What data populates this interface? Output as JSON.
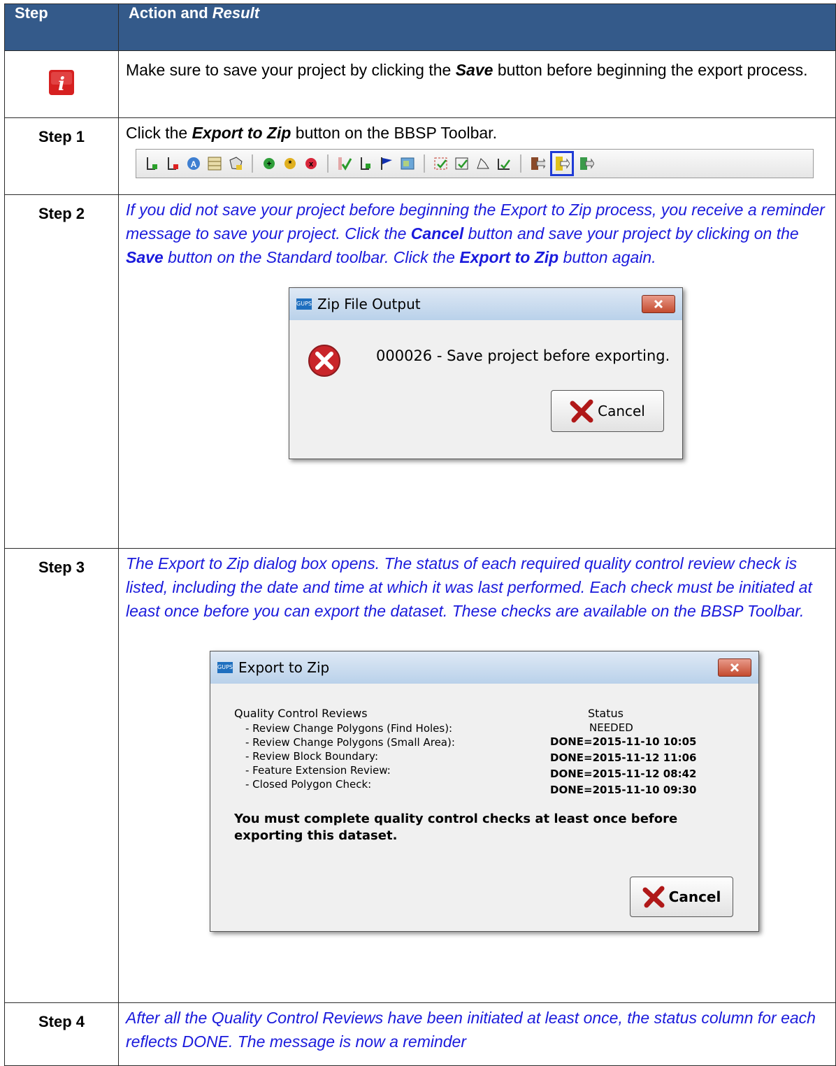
{
  "header": {
    "step": "Step",
    "action_prefix": "Action and ",
    "action_suffix": "Result"
  },
  "info_row": {
    "icon": "info-icon",
    "text_before": "Make sure to save your project by clicking the ",
    "save": "Save",
    "text_after": " button before beginning the export process."
  },
  "step1": {
    "label": "Step 1",
    "text_before": "Click the ",
    "export_label": "Export to Zip",
    "text_after": " button on the BBSP Toolbar."
  },
  "toolbar": {
    "icons": [
      "add-line-icon",
      "delete-line-icon",
      "address-icon",
      "table-icon",
      "polygon-icon",
      "add-point-icon",
      "edit-point-icon",
      "delete-point-icon",
      "2010-check-icon",
      "line-check-icon",
      "flag-icon",
      "map-icon",
      "review-icon",
      "review2-icon",
      "shape-icon",
      "check-icon",
      "export1-icon",
      "export-zip-icon",
      "export2-icon"
    ]
  },
  "step2": {
    "label": "Step 2",
    "t1": "If you did not save your project before beginning the Export to Zip process, you receive a reminder message to save your project. Click the ",
    "cancel": "Cancel",
    "t2": " button and save your project by clicking on the ",
    "save": "Save",
    "t3": " button on the Standard toolbar.  Click the ",
    "export": "Export to Zip",
    "t4": " button again."
  },
  "zip_dialog": {
    "app_icon": "GUPS",
    "title": "Zip File Output",
    "message": "000026 - Save project before exporting.",
    "cancel": "Cancel"
  },
  "step3": {
    "label": "Step 3",
    "text": "The Export to Zip dialog box opens. The status of each required quality control review check is listed, including the date and time at which it was last performed. Each check must be initiated at least once before you can export the dataset. These checks are available on the BBSP Toolbar."
  },
  "export_dialog": {
    "app_icon": "GUPS",
    "title": "Export to Zip",
    "col1": "Quality Control Reviews",
    "col2": "Status",
    "reviews": [
      {
        "name": "- Review Change Polygons (Find Holes):",
        "status": "NEEDED"
      },
      {
        "name": "- Review Change Polygons (Small Area):",
        "status": "DONE=2015-11-10 10:05"
      },
      {
        "name": "- Review Block Boundary:",
        "status": "DONE=2015-11-12 11:06"
      },
      {
        "name": "- Feature Extension Review:",
        "status": "DONE=2015-11-12 08:42"
      },
      {
        "name": "- Closed Polygon Check:",
        "status": "DONE=2015-11-10 09:30"
      }
    ],
    "warning": "You must complete quality control checks at least once before exporting this dataset.",
    "cancel": "Cancel"
  },
  "step4": {
    "label": "Step 4",
    "text": "After all the Quality Control Reviews have been initiated at least once, the status column for each reflects DONE. The message is now a reminder"
  }
}
